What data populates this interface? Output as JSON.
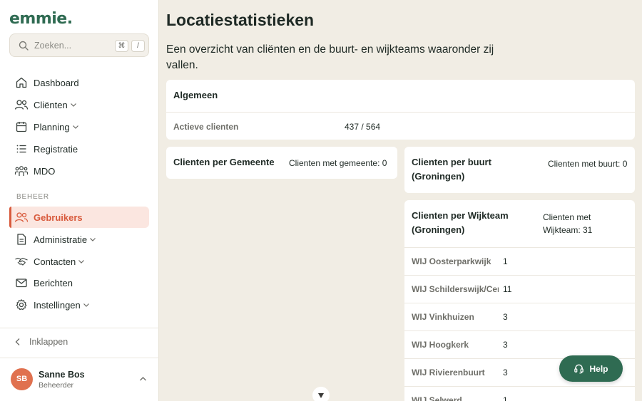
{
  "app": {
    "logo": "emmie."
  },
  "search": {
    "placeholder": "Zoeken...",
    "shortcut_1": "⌘",
    "shortcut_2": "/"
  },
  "nav": {
    "dashboard": "Dashboard",
    "clienten": "Cliënten",
    "planning": "Planning",
    "registratie": "Registratie",
    "mdo": "MDO",
    "section_beheer": "BEHEER",
    "gebruikers": "Gebruikers",
    "administratie": "Administratie",
    "contacten": "Contacten",
    "berichten": "Berichten",
    "instellingen": "Instellingen",
    "collapse": "Inklappen"
  },
  "user": {
    "initials": "SB",
    "name": "Sanne Bos",
    "role": "Beheerder"
  },
  "page": {
    "title": "Locatiestatistieken",
    "subtitle": "Een overzicht van cliënten en de buurt- en wijkteams waaronder zij vallen."
  },
  "algemeen": {
    "title": "Algemeen",
    "label": "Actieve clienten",
    "value": "437 / 564"
  },
  "gemeente": {
    "title": "Clienten per Gemeente",
    "meta": "Clienten met gemeente: 0"
  },
  "buurt": {
    "title": "Clienten per buurt (Groningen)",
    "meta": "Clienten met buurt: 0"
  },
  "wijkteam": {
    "title": "Clienten per Wijkteam (Groningen)",
    "meta": "Clienten met Wijkteam: 31",
    "rows": [
      {
        "name": "WIJ Oosterparkwijk",
        "value": "1"
      },
      {
        "name": "WIJ Schilderswijk/Centrum",
        "value": "11"
      },
      {
        "name": "WIJ Vinkhuizen",
        "value": "3"
      },
      {
        "name": "WIJ Hoogkerk",
        "value": "3"
      },
      {
        "name": "WIJ Rivierenbuurt",
        "value": "3"
      },
      {
        "name": "WIJ Selwerd",
        "value": "1"
      }
    ]
  },
  "help": {
    "label": "Help"
  },
  "colors": {
    "brand": "#2f6b52",
    "accent": "#d85a3c",
    "background": "#f1ede4"
  }
}
